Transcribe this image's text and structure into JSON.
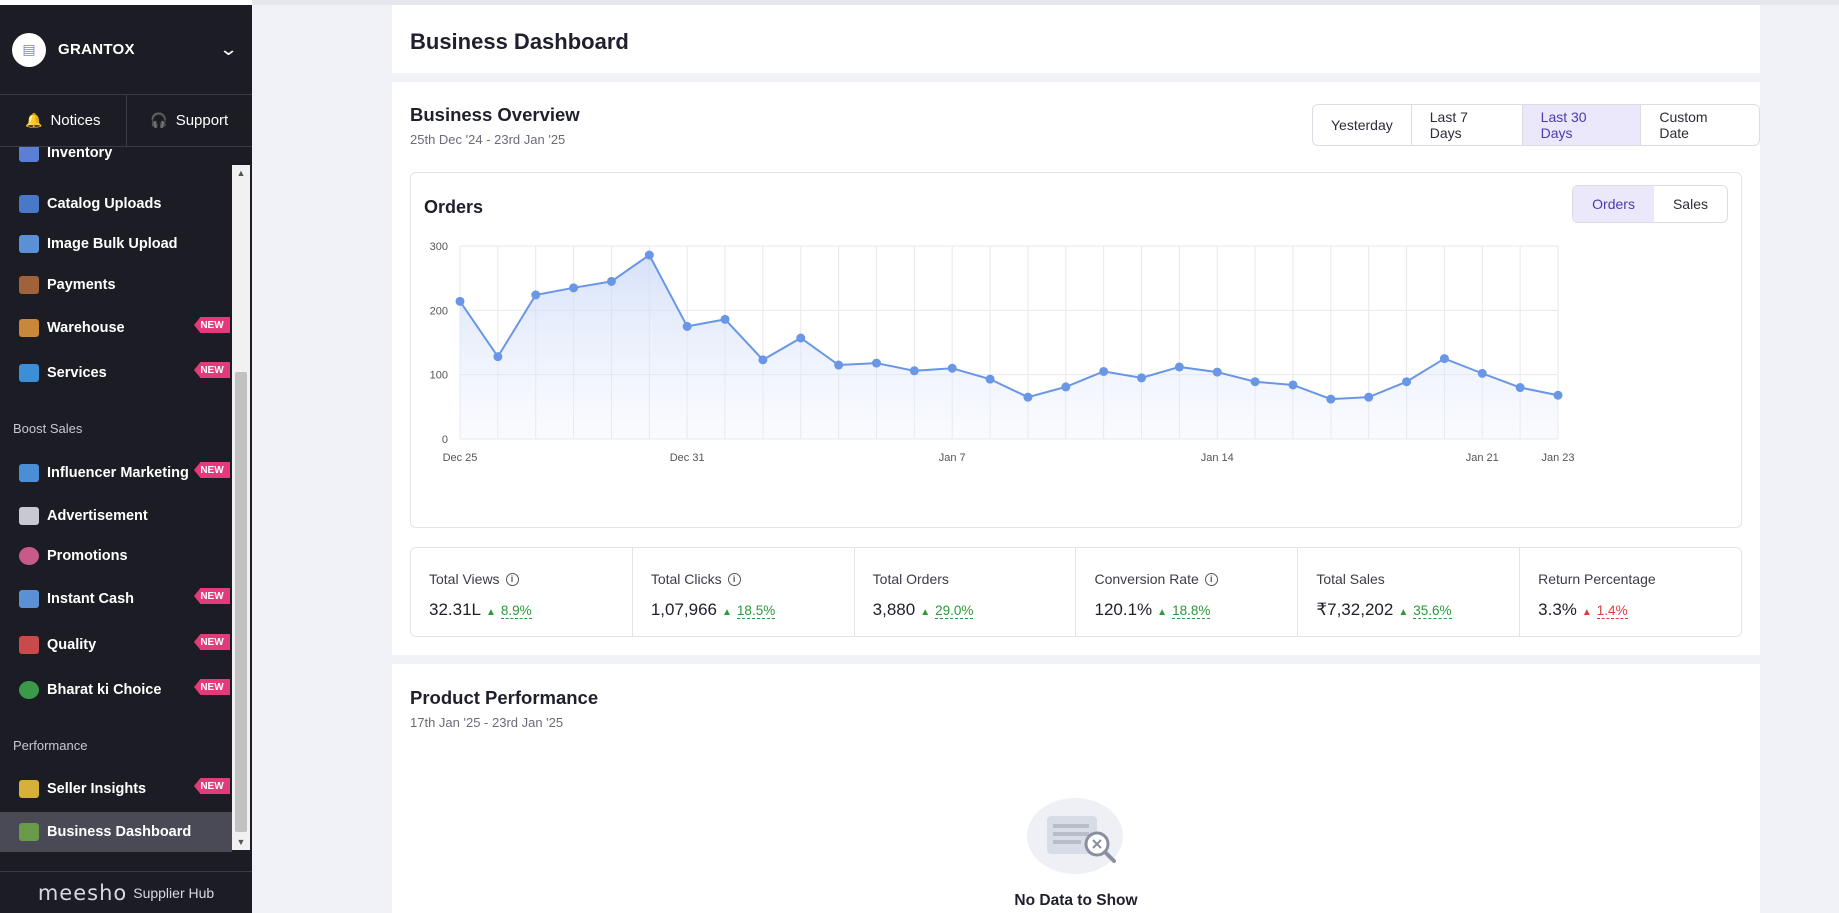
{
  "sidebar": {
    "brand": "GRANTOX",
    "help": {
      "notices": "Notices",
      "support": "Support"
    },
    "items": [
      {
        "label": "Inventory",
        "icon": "inventory-icon",
        "color": "#5b7fd6"
      },
      {
        "label": "Catalog Uploads",
        "icon": "upload-icon",
        "color": "#4a78c8"
      },
      {
        "label": "Image Bulk Upload",
        "icon": "image-icon",
        "color": "#5b8fd6"
      },
      {
        "label": "Payments",
        "icon": "wallet-icon",
        "color": "#a0623a"
      },
      {
        "label": "Warehouse",
        "icon": "warehouse-icon",
        "color": "#c9873a",
        "badge": "NEW"
      },
      {
        "label": "Services",
        "icon": "toolbox-icon",
        "color": "#3a8fd6",
        "badge": "NEW"
      },
      {
        "label": "Influencer Marketing",
        "icon": "influencer-icon",
        "color": "#4a8fd6",
        "badge": "NEW"
      },
      {
        "label": "Advertisement",
        "icon": "megaphone-icon",
        "color": "#c8c8d0"
      },
      {
        "label": "Promotions",
        "icon": "percent-icon",
        "color": "#c85a8a"
      },
      {
        "label": "Instant Cash",
        "icon": "bank-icon",
        "color": "#5b8fd6",
        "badge": "NEW"
      },
      {
        "label": "Quality",
        "icon": "quality-icon",
        "color": "#c84a4a",
        "badge": "NEW"
      },
      {
        "label": "Bharat ki Choice",
        "icon": "star-badge-icon",
        "color": "#3a9a4a",
        "badge": "NEW"
      },
      {
        "label": "Seller Insights",
        "icon": "bulb-icon",
        "color": "#d6b03a",
        "badge": "NEW"
      },
      {
        "label": "Business Dashboard",
        "icon": "bar-chart-icon",
        "color": "#6a9a4a"
      }
    ],
    "groups": {
      "boost": "Boost Sales",
      "performance": "Performance"
    },
    "footer": {
      "logo": "meesho",
      "sub": "Supplier Hub"
    }
  },
  "header": {
    "title": "Business Dashboard"
  },
  "overview": {
    "title": "Business Overview",
    "date_range": "25th Dec '24 - 23rd Jan '25",
    "ranges": [
      "Yesterday",
      "Last 7 Days",
      "Last 30 Days",
      "Custom Date"
    ],
    "active_range": "Last 30 Days",
    "chart_title": "Orders",
    "metric_tabs": [
      "Orders",
      "Sales"
    ],
    "active_metric": "Orders",
    "stats": [
      {
        "label": "Total Views",
        "info": true,
        "value": "32.31L",
        "change": "8.9%",
        "direction": "up"
      },
      {
        "label": "Total Clicks",
        "info": true,
        "value": "1,07,966",
        "change": "18.5%",
        "direction": "up"
      },
      {
        "label": "Total Orders",
        "info": false,
        "value": "3,880",
        "change": "29.0%",
        "direction": "up"
      },
      {
        "label": "Conversion Rate",
        "info": true,
        "value": "120.1%",
        "change": "18.8%",
        "direction": "up"
      },
      {
        "label": "Total Sales",
        "info": false,
        "value": "₹7,32,202",
        "change": "35.6%",
        "direction": "up"
      },
      {
        "label": "Return Percentage",
        "info": false,
        "value": "3.3%",
        "change": "1.4%",
        "direction": "up-bad"
      }
    ]
  },
  "product": {
    "title": "Product Performance",
    "date_range": "17th Jan '25 - 23rd Jan '25",
    "empty_text": "No Data to Show"
  },
  "colors": {
    "accent": "#4a3bb3",
    "line": "#6a96e6",
    "up": "#2a9a3a",
    "down": "#e03b3b",
    "badge": "#e23a7a"
  },
  "chart_data": {
    "type": "area",
    "title": "Orders",
    "x_tick_labels": [
      "Dec 25",
      "Dec 31",
      "Jan 7",
      "Jan 14",
      "Jan 21",
      "Jan 23"
    ],
    "x": [
      "Dec 25",
      "Dec 26",
      "Dec 27",
      "Dec 28",
      "Dec 29",
      "Dec 30",
      "Dec 31",
      "Jan 1",
      "Jan 2",
      "Jan 3",
      "Jan 4",
      "Jan 5",
      "Jan 6",
      "Jan 7",
      "Jan 8",
      "Jan 9",
      "Jan 10",
      "Jan 11",
      "Jan 12",
      "Jan 13",
      "Jan 14",
      "Jan 15",
      "Jan 16",
      "Jan 17",
      "Jan 18",
      "Jan 19",
      "Jan 20",
      "Jan 21",
      "Jan 22",
      "Jan 23"
    ],
    "values": [
      214,
      128,
      224,
      235,
      245,
      286,
      175,
      186,
      123,
      157,
      115,
      118,
      106,
      110,
      93,
      65,
      81,
      105,
      95,
      112,
      104,
      89,
      84,
      62,
      65,
      89,
      125,
      102,
      80,
      68
    ],
    "yticks": [
      0,
      100,
      200,
      300
    ],
    "ylim": [
      0,
      300
    ],
    "grid": true
  }
}
